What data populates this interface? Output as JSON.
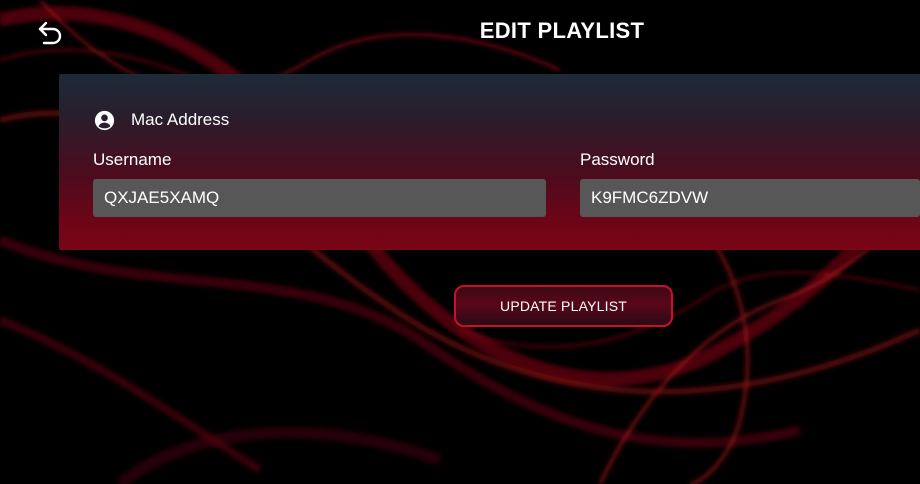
{
  "header": {
    "title": "EDIT PLAYLIST",
    "back_icon": "back-arrow-icon"
  },
  "form": {
    "mac_icon": "account-circle-icon",
    "mac_label": "Mac Address",
    "username_label": "Username",
    "username_value": "QXJAE5XAMQ",
    "password_label": "Password",
    "password_value": "K9FMC6ZDVW"
  },
  "actions": {
    "update_label": "UPDATE PLAYLIST"
  },
  "colors": {
    "accent": "#c8102e",
    "field_bg": "#575757",
    "background": "#000000"
  }
}
